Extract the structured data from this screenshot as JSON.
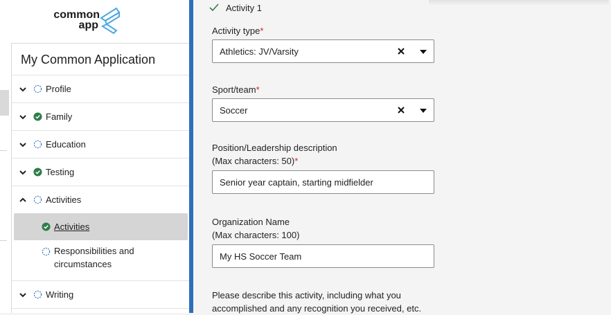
{
  "brand": {
    "logo_line1": "common",
    "logo_line2": "app"
  },
  "sidebar": {
    "title": "My Common Application",
    "items": [
      {
        "label": "Profile",
        "status": "incomplete",
        "expanded": false
      },
      {
        "label": "Family",
        "status": "complete",
        "expanded": false
      },
      {
        "label": "Education",
        "status": "incomplete",
        "expanded": false
      },
      {
        "label": "Testing",
        "status": "complete",
        "expanded": false
      },
      {
        "label": "Activities",
        "status": "incomplete",
        "expanded": true,
        "children": [
          {
            "label": "Activities",
            "status": "complete",
            "active": true
          },
          {
            "label": "Responsibilities and circumstances",
            "status": "incomplete",
            "active": false
          }
        ]
      },
      {
        "label": "Writing",
        "status": "incomplete",
        "expanded": false
      }
    ]
  },
  "activity": {
    "header": "Activity 1",
    "type_label": "Activity type",
    "type_value": "Athletics: JV/Varsity",
    "sport_label": "Sport/team",
    "sport_value": "Soccer",
    "position_label_line1": "Position/Leadership description",
    "position_label_line2": "(Max characters: 50)",
    "position_value": "Senior year captain, starting midfielder",
    "org_label_line1": "Organization Name",
    "org_label_line2": "(Max characters: 100)",
    "org_value": "My HS Soccer Team",
    "desc_label_line1": "Please describe this activity, including what you",
    "desc_label_line2": "accomplished and any recognition you received, etc.",
    "required_mark": "*"
  },
  "colors": {
    "accent": "#2f6fba",
    "complete": "#2e7d4a",
    "incomplete": "#2f6fba",
    "required": "#c62828",
    "logo_blue": "#4aa8e0"
  },
  "icons": {
    "complete": "check-circle-icon",
    "incomplete": "dashed-circle-icon",
    "expand": "chevron-down-icon",
    "collapse": "chevron-up-icon",
    "clear": "close-icon",
    "dropdown": "caret-down-icon",
    "header_check": "check-icon"
  }
}
